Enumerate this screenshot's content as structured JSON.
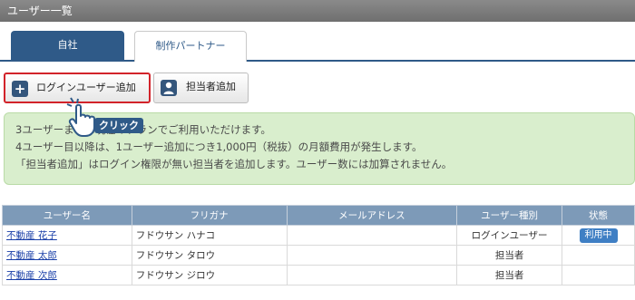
{
  "header": {
    "title": "ユーザー一覧"
  },
  "tabs": [
    {
      "label": "自社",
      "active": true
    },
    {
      "label": "制作パートナー",
      "active": false
    }
  ],
  "actions": {
    "add_login_user": "ログインユーザー追加",
    "add_manager": "担当者追加"
  },
  "notice": {
    "lines": [
      "3ユーザーまでは現在のプランでご利用いただけます。",
      "4ユーザー目以降は、1ユーザー追加につき1,000円（税抜）の月額費用が発生します。",
      "「担当者追加」はログイン権限が無い担当者を追加します。ユーザー数には加算されません。"
    ]
  },
  "annotation": {
    "click_label": "クリック"
  },
  "table": {
    "columns": [
      "ユーザー名",
      "フリガナ",
      "メールアドレス",
      "ユーザー種別",
      "状態"
    ],
    "rows": [
      {
        "name": "不動産 花子",
        "furigana": "フドウサン ハナコ",
        "email": "",
        "type": "ログインユーザー",
        "status": "利用中"
      },
      {
        "name": "不動産 太郎",
        "furigana": "フドウサン タロウ",
        "email": "",
        "type": "担当者",
        "status": ""
      },
      {
        "name": "不動産 次郎",
        "furigana": "フドウサン ジロウ",
        "email": "",
        "type": "担当者",
        "status": ""
      }
    ]
  },
  "colors": {
    "primary": "#2f5a88",
    "table_header": "#7d9ab8",
    "notice_bg": "#d9eecd",
    "highlight": "#d2232a",
    "badge": "#3f7fc4"
  }
}
